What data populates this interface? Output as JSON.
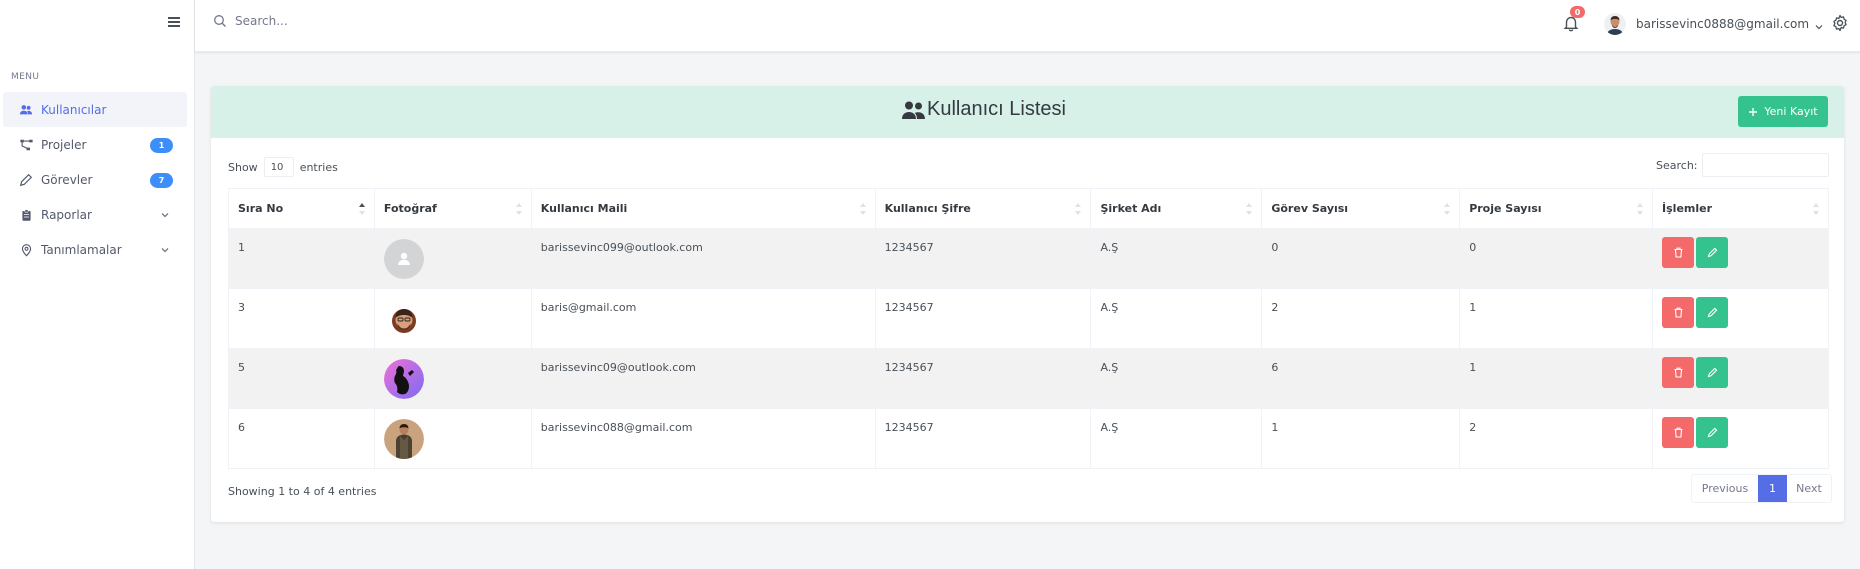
{
  "search": {
    "placeholder": "Search..."
  },
  "topbar": {
    "notification_count": "0",
    "user_email": "barissevinc0888@gmail.com"
  },
  "sidebar": {
    "menu_title": "MENU",
    "items": [
      {
        "label": "Kullanıcılar",
        "icon": "users-icon",
        "active": true
      },
      {
        "label": "Projeler",
        "icon": "sitemap-icon",
        "badge": "1"
      },
      {
        "label": "Görevler",
        "icon": "pencil-icon",
        "badge": "7"
      },
      {
        "label": "Raporlar",
        "icon": "clipboard-icon",
        "has_submenu": true
      },
      {
        "label": "Tanımlamalar",
        "icon": "location-icon",
        "has_submenu": true
      }
    ]
  },
  "card": {
    "title": "Kullanıcı Listesi",
    "new_button": "Yeni Kayıt",
    "accent_color": "#d7f0e8"
  },
  "table_controls": {
    "show_label": "Show",
    "entries_value": "10",
    "entries_label": "entries",
    "search_label": "Search:"
  },
  "table": {
    "headers": [
      "Sıra No",
      "Fotoğraf",
      "Kullanıcı Maili",
      "Kullanıcı Şifre",
      "Şirket Adı",
      "Görev Sayısı",
      "Proje Sayısı",
      "İşlemler"
    ],
    "rows": [
      {
        "no": "1",
        "email": "barissevinc099@outlook.com",
        "password": "1234567",
        "company": "A.Ş",
        "tasks": "0",
        "projects": "0"
      },
      {
        "no": "3",
        "email": "baris@gmail.com",
        "password": "1234567",
        "company": "A.Ş",
        "tasks": "2",
        "projects": "1"
      },
      {
        "no": "5",
        "email": "barissevinc09@outlook.com",
        "password": "1234567",
        "company": "A.Ş",
        "tasks": "6",
        "projects": "1"
      },
      {
        "no": "6",
        "email": "barissevinc088@gmail.com",
        "password": "1234567",
        "company": "A.Ş",
        "tasks": "1",
        "projects": "2"
      }
    ]
  },
  "footer": {
    "info": "Showing 1 to 4 of 4 entries",
    "previous": "Previous",
    "current_page": "1",
    "next": "Next"
  },
  "colors": {
    "primary": "#556ee6",
    "success": "#34c38f",
    "danger": "#f46a6a",
    "info": "#3d8ef8"
  }
}
